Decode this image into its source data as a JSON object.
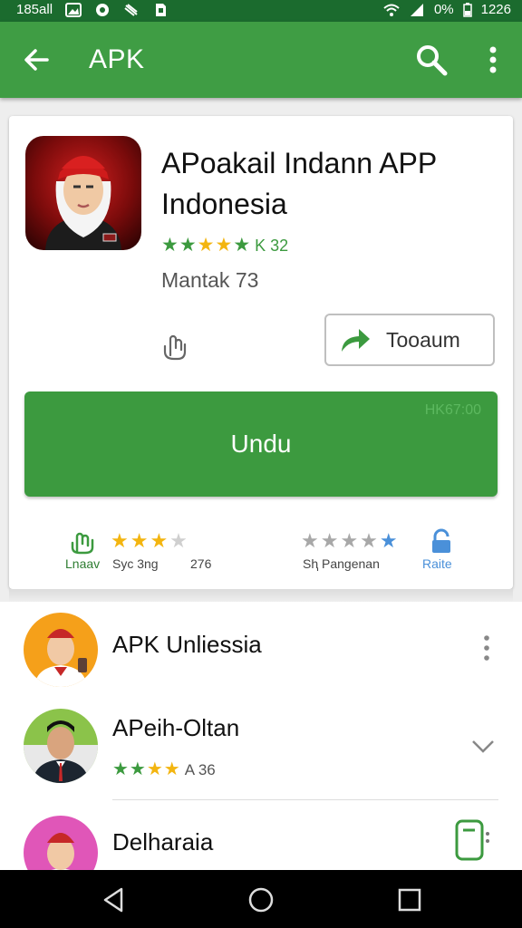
{
  "status_bar": {
    "left_text": "185all",
    "battery_text": "0%",
    "time": "1226"
  },
  "appbar": {
    "title": "APK"
  },
  "app": {
    "name": "APoakail Indann APP Indonesia",
    "rating_text": "K 32",
    "rating": 4.5,
    "developer": "Mantak 73",
    "share_label": "Tooaum",
    "install_label": "Undu",
    "size_text": "HK67:00"
  },
  "stats": [
    {
      "label": "Lnaav"
    },
    {
      "label": "Syc  3ng",
      "stars": 3
    },
    {
      "label": "276"
    },
    {
      "label": "Sⱨ  Pangenan",
      "stars": 5
    },
    {
      "label": "Raite"
    }
  ],
  "list": [
    {
      "title": "APK Unliessia"
    },
    {
      "title": "APeih-Oltan",
      "rating_text": "A 36",
      "rating": 4
    },
    {
      "title": "Delharaia"
    }
  ],
  "colors": {
    "primary": "#3f9d44",
    "statusbar": "#1b6b2e",
    "star_green": "#3c9a3f",
    "star_gold": "#f3b510"
  }
}
